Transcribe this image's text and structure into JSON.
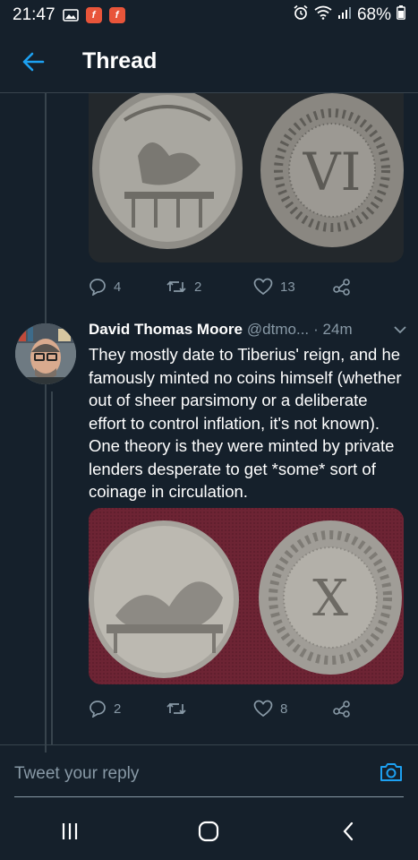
{
  "status_bar": {
    "time": "21:47",
    "battery": "68%",
    "icons": [
      "gallery-icon",
      "app-f-icon",
      "app-f-icon",
      "alarm-icon",
      "wifi-icon",
      "signal-icon",
      "battery-icon"
    ],
    "app_badge_letter": "f"
  },
  "header": {
    "title": "Thread",
    "back_icon": "arrow-left-icon",
    "accent": "#1da1f2"
  },
  "tweet1_actions": {
    "replies": "4",
    "retweets": "2",
    "likes": "13"
  },
  "tweet2": {
    "author_name": "David Thomas Moore",
    "author_handle": "@dtmo...",
    "time": "· 24m",
    "text": "They mostly date to Tiberius' reign, and he famously minted no coins himself (whether out of sheer parsimony or a deliberate effort to control inflation, it's not known). One theory is they were minted by private lenders desperate to get *some* sort of coinage in circulation.",
    "replies": "2",
    "retweets": "",
    "likes": "8"
  },
  "coin_images": {
    "coin1_numeral": "VI",
    "coin2_numeral": "X"
  },
  "reply_bar": {
    "placeholder": "Tweet your reply",
    "camera_icon": "camera-icon"
  },
  "nav_bar": {
    "icons": [
      "recent-apps-icon",
      "home-icon",
      "back-icon"
    ]
  },
  "colors": {
    "background": "#15202b",
    "border": "#38444d",
    "secondary_text": "#8899a6"
  }
}
